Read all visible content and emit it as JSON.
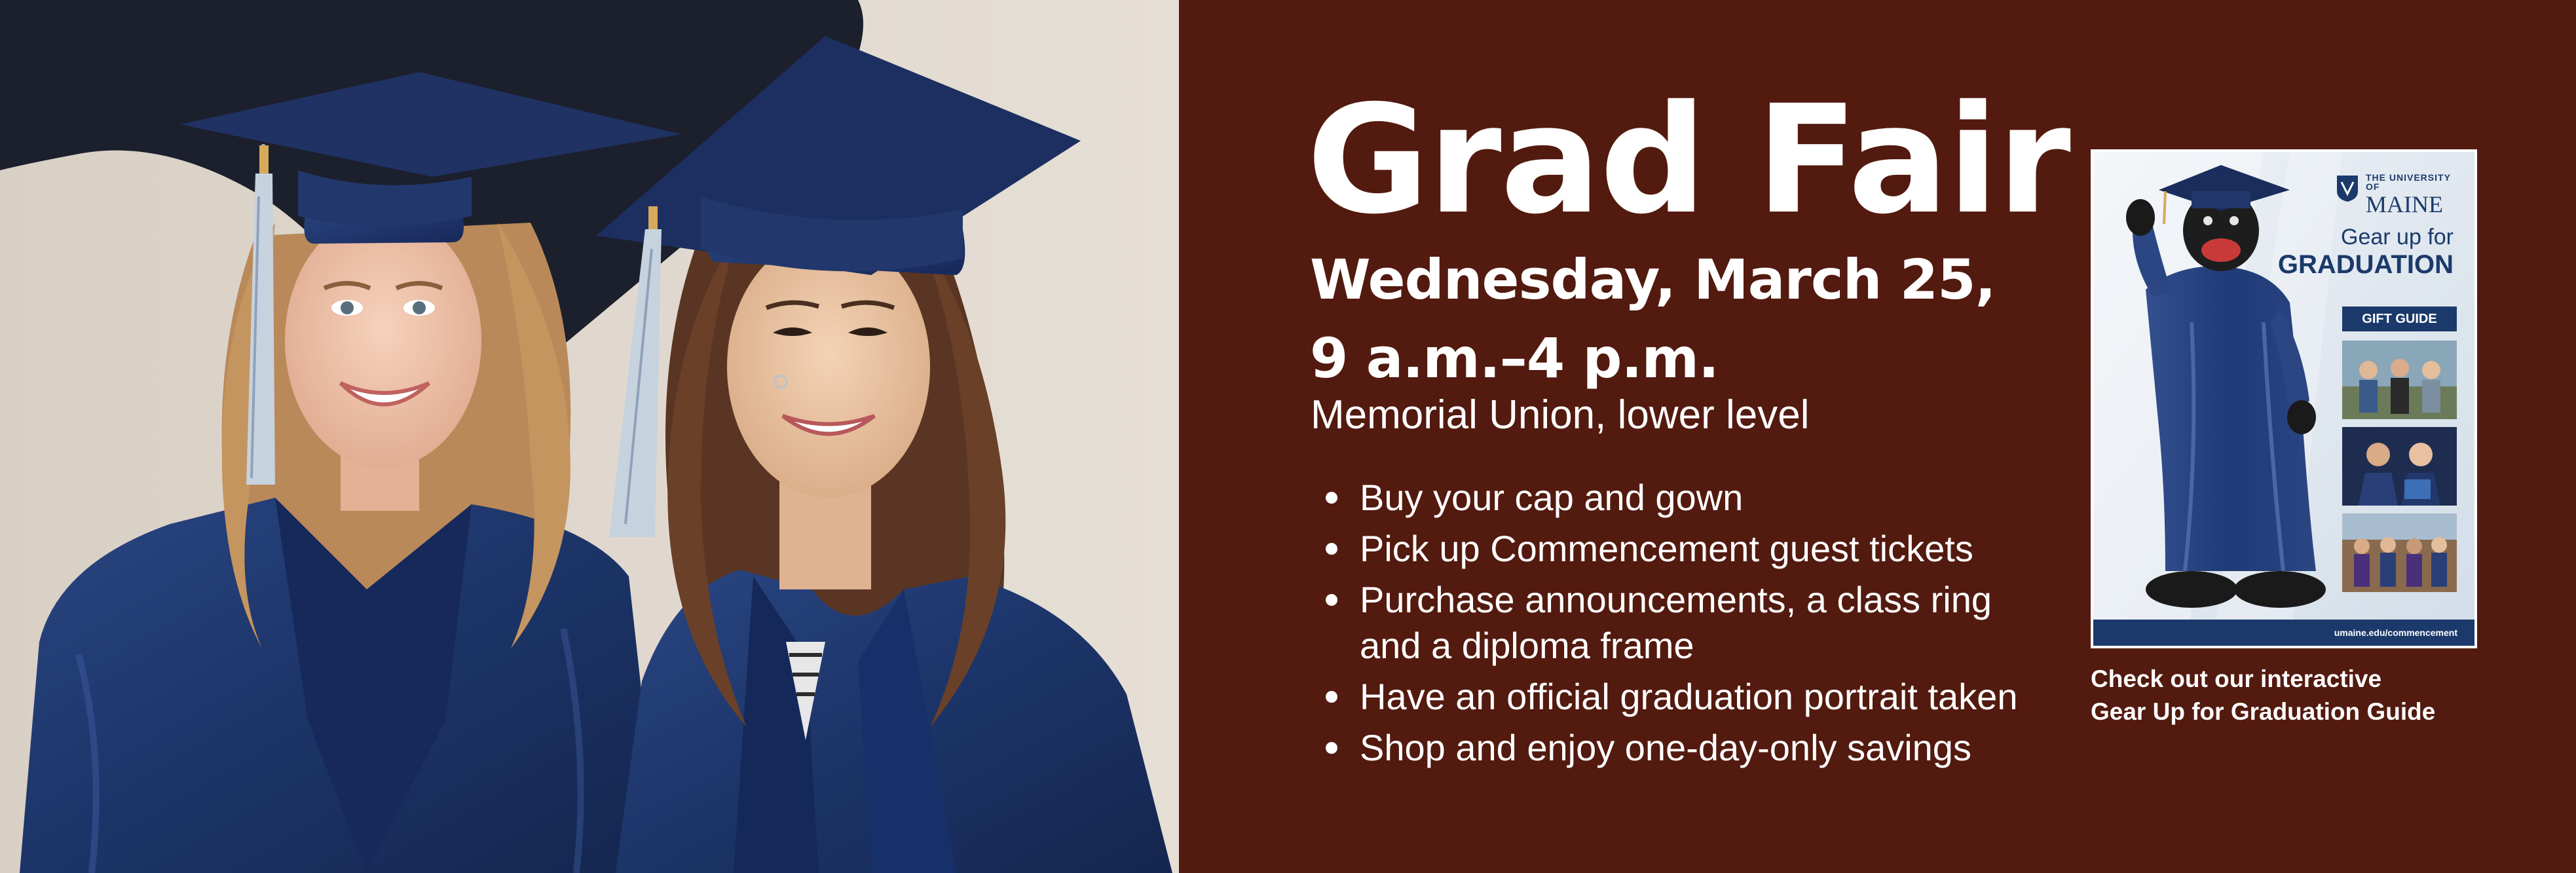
{
  "event": {
    "title": "Grad Fair",
    "date": "Wednesday, March 25,",
    "time": "9 a.m.–4 p.m.",
    "location": "Memorial Union, lower level"
  },
  "benefits": [
    "Buy your cap and gown",
    "Pick up Commencement guest tickets",
    "Purchase announcements, a class ring",
    "and a diploma frame",
    "Have an official graduation portrait taken",
    "Shop and enjoy one-day-only savings"
  ],
  "guide": {
    "logo_top": "THE UNIVERSITY OF",
    "logo_name": "MAINE",
    "title_line1": "Gear up for",
    "title_line2": "GRADUATION",
    "badge": "GIFT GUIDE",
    "url": "umaine.edu/commencement",
    "caption_line1": "Check out our interactive",
    "caption_line2": "Gear Up for Graduation Guide"
  },
  "colors": {
    "background": "#531a0f",
    "text": "#ffffff",
    "gown": "#1f3766",
    "guide_navy": "#1b3a6b"
  },
  "icons": [
    "bullet-dot-icon",
    "university-shield-icon"
  ]
}
